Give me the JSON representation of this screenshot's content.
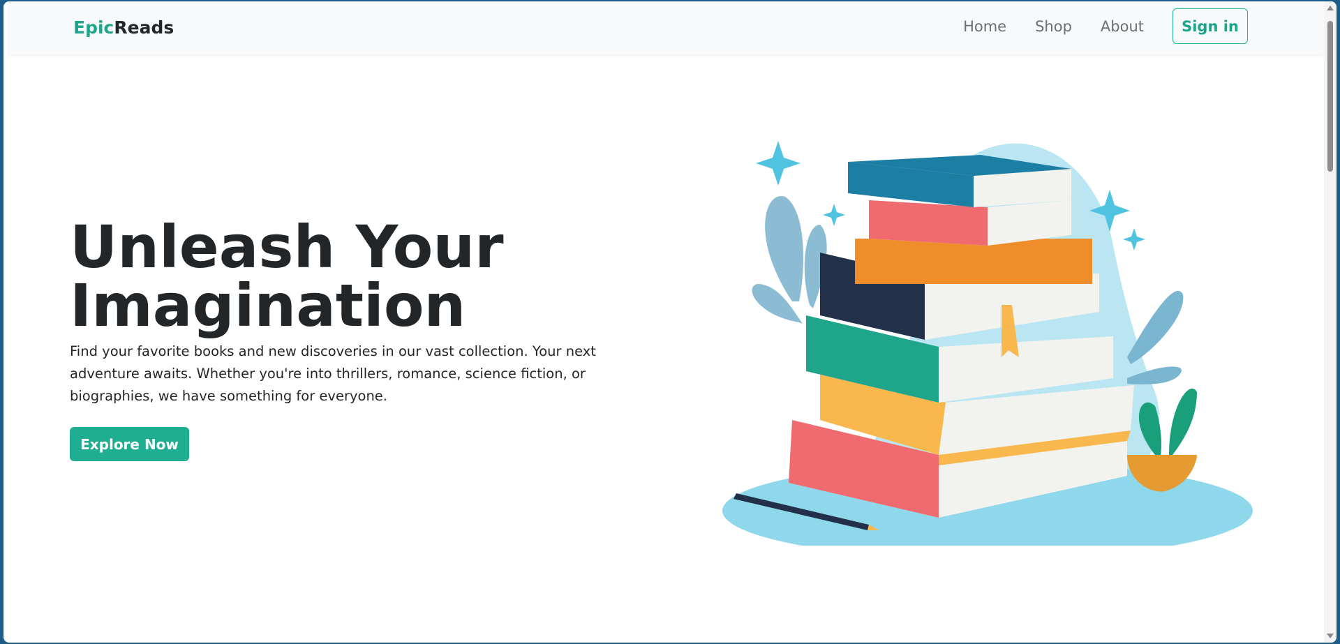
{
  "nav": {
    "brand_accent": "Epic",
    "brand_rest": "Reads",
    "links": [
      "Home",
      "Shop",
      "About"
    ],
    "signin_label": "Sign in"
  },
  "hero": {
    "title_line1": "Unleash Your",
    "title_line2": "Imagination",
    "description": "Find your favorite books and new discoveries in our vast collection. Your next adventure awaits. Whether you're into thrillers, romance, science fiction, or biographies, we have something for everyone.",
    "cta_label": "Explore Now"
  },
  "illustration": {
    "icon": "book-stack-illustration"
  },
  "colors": {
    "accent": "#1fae92",
    "text": "#222629",
    "nav_bg": "#f8f9fb",
    "desktop_bg": "#1d5d87"
  }
}
